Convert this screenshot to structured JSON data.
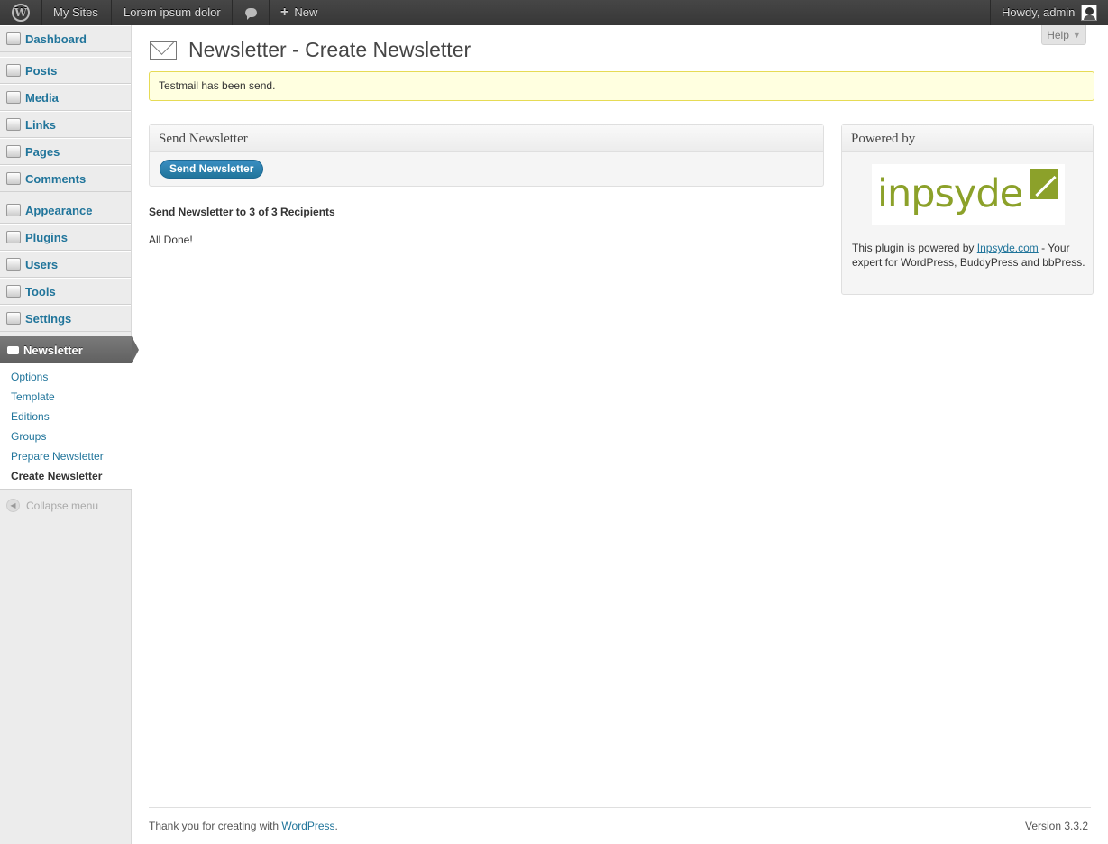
{
  "adminbar": {
    "my_sites": "My Sites",
    "site_name": "Lorem ipsum dolor",
    "new_label": "New",
    "howdy": "Howdy, admin"
  },
  "sidebar": {
    "items": [
      {
        "label": "Dashboard",
        "icon": "dashboard-icon"
      },
      {
        "label": "Posts",
        "icon": "pin-icon"
      },
      {
        "label": "Media",
        "icon": "media-icon"
      },
      {
        "label": "Links",
        "icon": "link-icon"
      },
      {
        "label": "Pages",
        "icon": "pages-icon"
      },
      {
        "label": "Comments",
        "icon": "comment-icon"
      },
      {
        "label": "Appearance",
        "icon": "appearance-icon"
      },
      {
        "label": "Plugins",
        "icon": "plug-icon"
      },
      {
        "label": "Users",
        "icon": "users-icon"
      },
      {
        "label": "Tools",
        "icon": "tools-icon"
      },
      {
        "label": "Settings",
        "icon": "settings-icon"
      },
      {
        "label": "Newsletter",
        "icon": "envelope-icon"
      }
    ],
    "submenu": [
      "Options",
      "Template",
      "Editions",
      "Groups",
      "Prepare Newsletter",
      "Create Newsletter"
    ],
    "collapse": "Collapse menu"
  },
  "help": "Help",
  "page": {
    "title": "Newsletter - Create Newsletter",
    "notice": "Testmail has been send.",
    "send_box_title": "Send Newsletter",
    "send_button": "Send Newsletter",
    "recipients_heading": "Send Newsletter to 3 of 3 Recipients",
    "status": "All Done!"
  },
  "powered": {
    "title": "Powered by",
    "logo_text": "inpsyde",
    "text_before": "This plugin is powered by ",
    "link_text": "Inpsyde.com",
    "text_after": " - Your expert for WordPress, BuddyPress and bbPress."
  },
  "footer": {
    "thanks": "Thank you for creating with ",
    "wp_link": "WordPress",
    "dot": ".",
    "version": "Version 3.3.2"
  },
  "colors": {
    "link": "#21759b",
    "brand_green": "#8ca12a",
    "notice_bg": "#ffffe0"
  }
}
